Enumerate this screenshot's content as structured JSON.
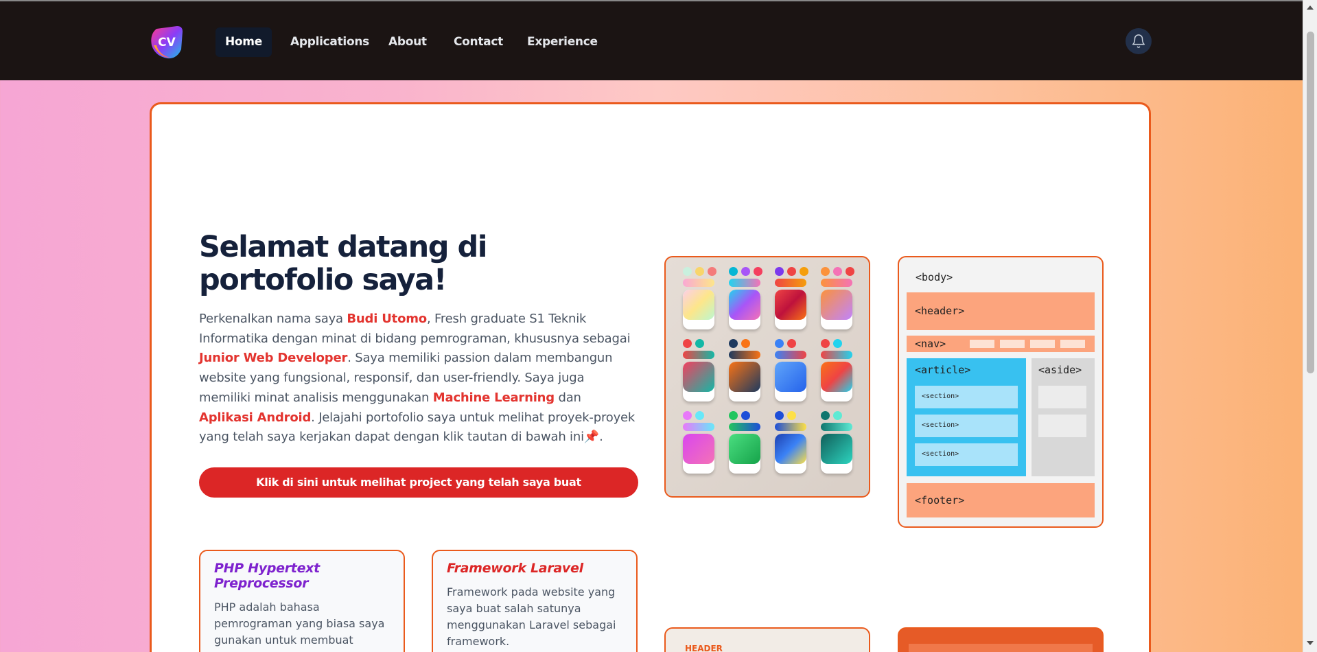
{
  "nav": {
    "logo_text": "CV",
    "items": [
      {
        "label": "Home",
        "active": true
      },
      {
        "label": "Applications"
      },
      {
        "label": "About"
      },
      {
        "label": "Contact"
      },
      {
        "label": "Experience"
      }
    ],
    "bell_icon": "bell-icon"
  },
  "hero": {
    "title": "Selamat datang di portofolio saya!",
    "text_parts": {
      "p1": "Perkenalkan nama saya ",
      "name": "Budi Utomo",
      "p2": ", Fresh graduate S1 Teknik Informatika dengan minat di bidang pemrograman, khususnya sebagai ",
      "role": "Junior Web Developer",
      "p3": ". Saya memiliki passion dalam membangun website yang fungsional, responsif, dan user-friendly. Saya juga memiliki minat analisis menggunakan ",
      "ml": "Machine Learning",
      "p4": " dan ",
      "android": "Aplikasi Android",
      "p5": ". Jelajahi portofolio saya untuk melihat proyek-proyek yang telah saya kerjakan dapat dengan klik tautan di bawah ini",
      "pin": "📌",
      "p6": "."
    },
    "cta_label": "Klik di sini untuk melihat project yang telah saya buat"
  },
  "cards": [
    {
      "title": "PHP Hypertext Preprocessor",
      "text": "PHP adalah bahasa pemrograman yang biasa saya gunakan untuk membuat aplikasi berbasis website.",
      "title_color": "#7e22ce"
    },
    {
      "title": "Framework Laravel",
      "text": "Framework pada website yang saya buat salah satunya menggunakan Laravel sebagai framework.",
      "title_color": "#dc2626"
    }
  ],
  "layout_diagram": {
    "body": "<body>",
    "header": "<header>",
    "nav": "<nav>",
    "article": "<article>",
    "aside": "<aside>",
    "section": "<section>",
    "footer": "<footer>"
  },
  "bottom_image_label": "HEADER",
  "colors": {
    "accent": "#ea5a1c",
    "cta": "#dc2626",
    "nav_bg": "#1b1413"
  }
}
